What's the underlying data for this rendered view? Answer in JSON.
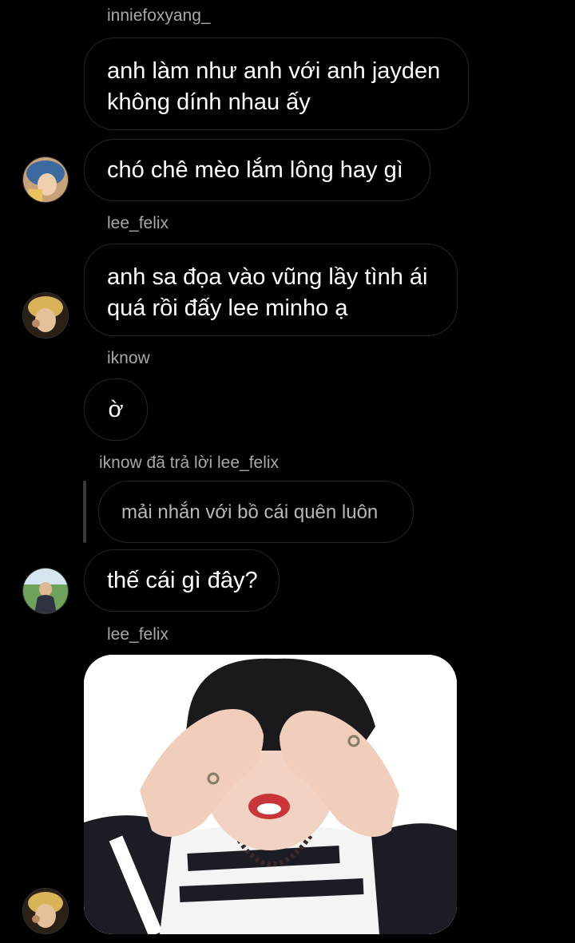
{
  "messages": [
    {
      "sender": "inniefoxyang_",
      "lines": [
        "anh làm như anh với anh jayden",
        "không dính nhau ấy"
      ]
    },
    {
      "lines": [
        "chó chê mèo lắm lông hay gì"
      ]
    },
    {
      "sender": "lee_felix",
      "lines": [
        "anh sa đọa vào vũng lầy tình ái",
        "quá rồi đấy lee minho ạ"
      ]
    },
    {
      "sender": "iknow",
      "lines": [
        "ờ"
      ]
    },
    {
      "reply_header": "iknow đã trả lời lee_felix",
      "quoted": "mải nhắn với bồ cái quên luôn"
    },
    {
      "lines": [
        "thế cái gì đây?"
      ]
    },
    {
      "sender": "lee_felix"
    }
  ],
  "colors": {
    "background": "#000000",
    "bubble_border": "#262626",
    "sender_text": "#a8a8a8"
  },
  "icons": [
    "avatar-blue-hair",
    "avatar-blonde",
    "avatar-outdoor",
    "avatar-blonde"
  ]
}
